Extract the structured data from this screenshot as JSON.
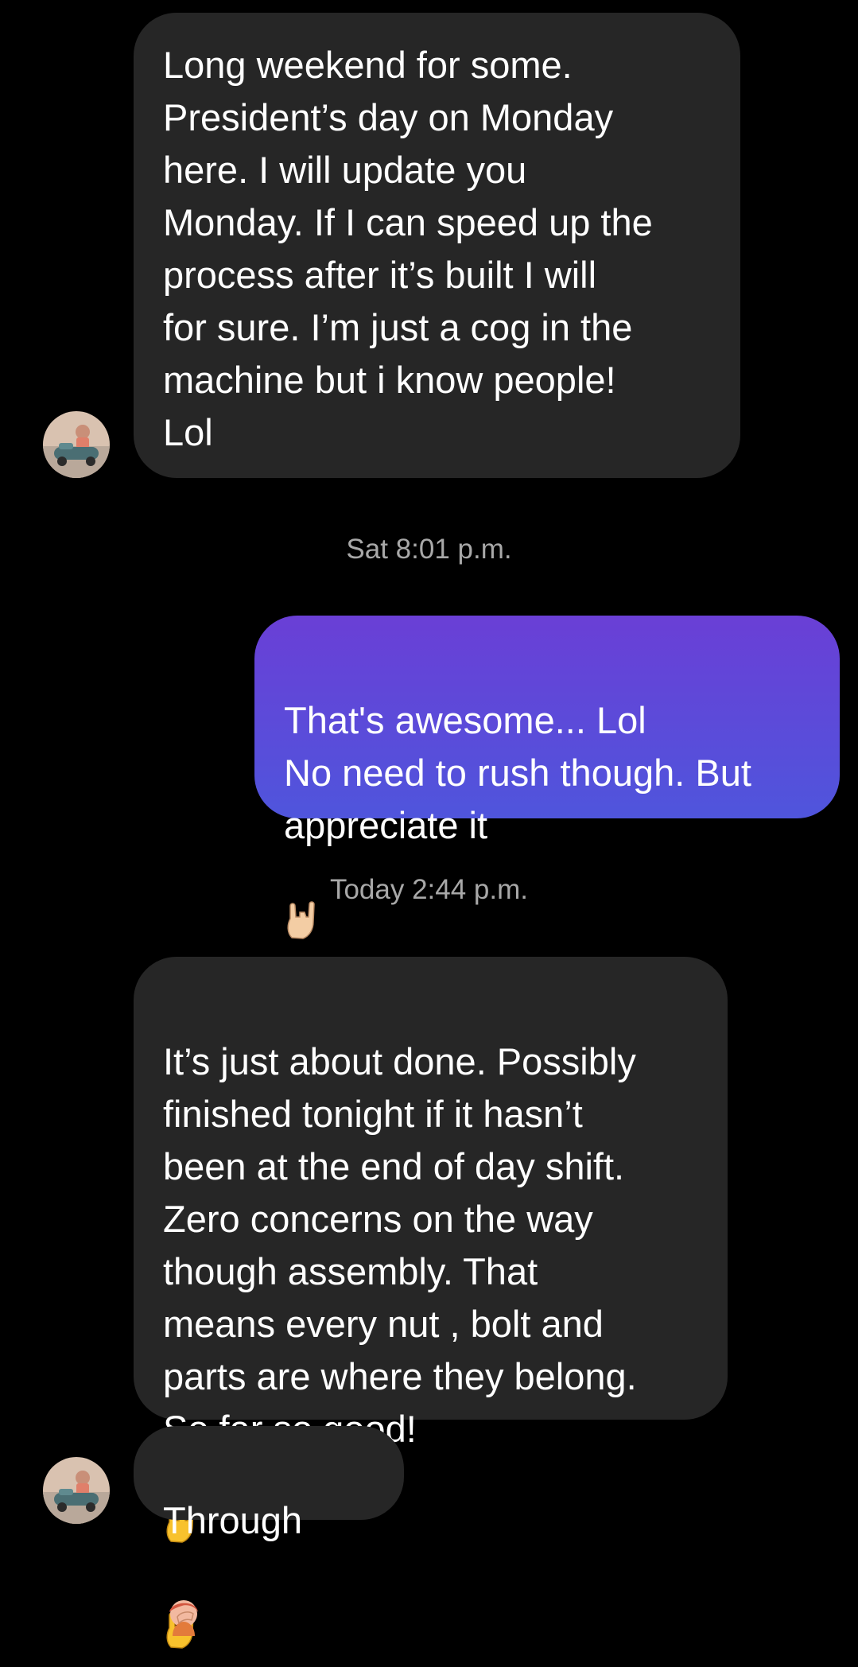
{
  "conversation": {
    "messages": [
      {
        "sender": "other",
        "text": "Long weekend for some.\nPresident’s day on Monday\nhere. I will update you\nMonday. If I can speed up the\nprocess after it’s built I will\nfor sure. I’m just a cog in the\nmachine but i know people!\nLol"
      },
      {
        "timestamp": "Sat 8:01 p.m."
      },
      {
        "sender": "me",
        "text": "That's awesome... Lol\nNo need to rush though. But\nappreciate it",
        "emoji": "horns-hand"
      },
      {
        "timestamp": "Today 2:44 p.m."
      },
      {
        "sender": "other",
        "text": "It’s just about done. Possibly\nfinished tonight if it hasn’t\nbeen at the end of day shift.\nZero concerns on the way\nthough assembly. That\nmeans every nut , bolt and\nparts are where they belong.\nSo far so good!",
        "emoji": [
          "horns-hand",
          "horns-hand"
        ]
      },
      {
        "sender": "other",
        "text": "Through",
        "emoji": "facepalm"
      }
    ]
  },
  "colors": {
    "background": "#000000",
    "incoming_bubble": "#262626",
    "outgoing_gradient_top": "#6a3fd6",
    "outgoing_gradient_bottom": "#4f55dc",
    "timestamp_text": "#a8a8a8",
    "message_text": "#ffffff"
  },
  "icons": {
    "avatar": "profile-avatar-car",
    "emoji_rock": "horns-hand-emoji",
    "emoji_facepalm": "facepalm-emoji"
  }
}
